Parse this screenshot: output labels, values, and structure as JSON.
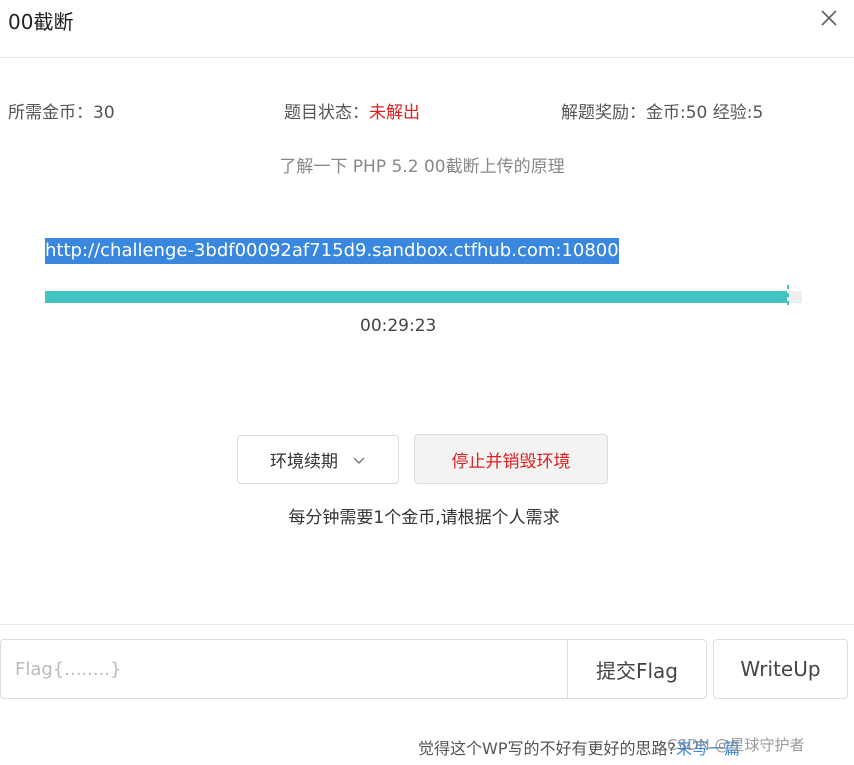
{
  "dialog": {
    "title": "00截断",
    "close_icon": "close-icon"
  },
  "info": {
    "cost_label": "所需金币：30",
    "status_label": "题目状态：",
    "status_value": "未解出",
    "reward_label": "解题奖励：金币:50 经验:5"
  },
  "description": "了解一下 PHP 5.2 00截断上传的原理",
  "environment": {
    "url": "http://challenge-3bdf00092af715d9.sandbox.ctfhub.com:10800",
    "progress_fraction": 0.98,
    "timer": "00:29:23"
  },
  "actions": {
    "renew_label": "环境续期",
    "renew_icon": "chevron-down-icon",
    "stop_label": "停止并销毁环境",
    "note": "每分钟需要1个金币,请根据个人需求"
  },
  "flag": {
    "placeholder": "Flag{........}",
    "value": "",
    "submit_label": "提交Flag",
    "writeup_label": "WriteUp"
  },
  "footer": {
    "note_prefix": "觉得这个WP写的不好有更好的思路?",
    "link": "来写一篇",
    "watermark": "CSDN @星球守护者"
  },
  "colors": {
    "accent": "#45c2c2",
    "danger": "#e02020",
    "link": "#3a87e0"
  }
}
